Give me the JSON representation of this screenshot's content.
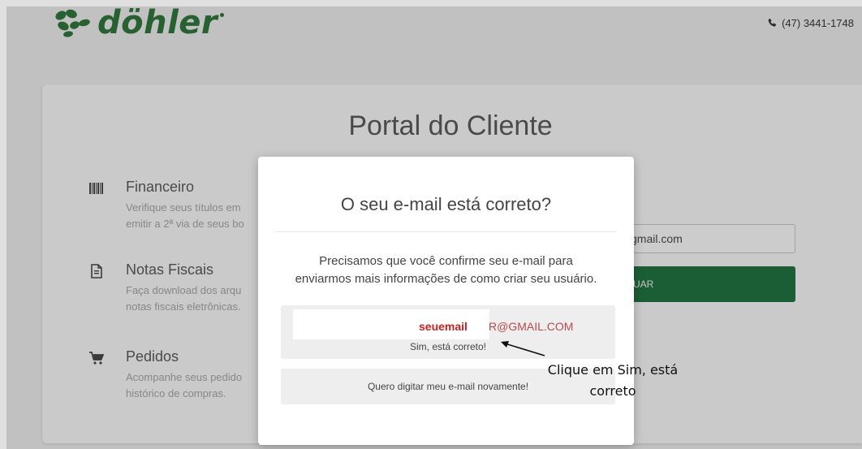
{
  "header": {
    "logo_text": "döhler",
    "phone": "(47) 3441-1748",
    "brand_color": "#2d6e38"
  },
  "portal": {
    "title": "Portal do Cliente",
    "features": [
      {
        "icon": "barcode-icon",
        "title": "Financeiro",
        "desc_line1": "Verifique seus títulos em",
        "desc_line2": "emitir a 2ª via de seus bo"
      },
      {
        "icon": "document-icon",
        "title": "Notas Fiscais",
        "desc_line1": "Faça download dos arqu",
        "desc_line2": "notas fiscais eletrônicas."
      },
      {
        "icon": "cart-icon",
        "title": "Pedidos",
        "desc_line1": "Acompanhe seus pedido",
        "desc_line2": "histórico de compras."
      }
    ],
    "email_field_value": "gmail.com",
    "submit_label": "UAR",
    "submit_color": "#1f6b3d"
  },
  "modal": {
    "title": "O seu e-mail está correto?",
    "message_line1": "Precisamos que você confirme seu e-mail para",
    "message_line2": "enviarmos mais informações de como criar seu usuário.",
    "email_left": "seuemail",
    "email_right": "R@GMAIL.COM",
    "confirm_label": "Sim, está correto!",
    "retype_label": "Quero digitar meu e-mail novamente!"
  },
  "annotation": {
    "line1": "Clique em Sim, está",
    "line2": "correto"
  }
}
